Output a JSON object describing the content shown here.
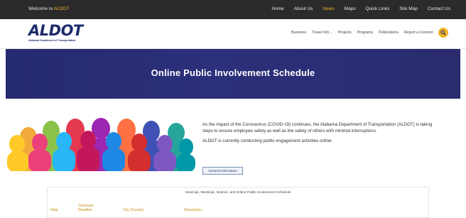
{
  "topbar": {
    "welcome_prefix": "Welcome to",
    "welcome_brand": "ALDOT",
    "links": [
      "Home",
      "About Us",
      "News",
      "Maps",
      "Quick Links",
      "Site Map",
      "Contact Us"
    ],
    "active_link": "News"
  },
  "header": {
    "logo_wordmark": "ALDOT",
    "logo_subtitle": "Alabama Department of Transportation",
    "nav": [
      "Business",
      "Travel Info",
      "Projects",
      "Programs",
      "Publications",
      "Report a Concern"
    ]
  },
  "hero": {
    "title": "Online Public Involvement Schedule"
  },
  "intro": {
    "paragraph_1": "As the impact of the Coronavirus (COVID-19) continues, the Alabama Department of Transportation (ALDOT) is taking steps to ensure employee safety as well as the safety of others with minimal interruptions.",
    "paragraph_2": "ALDOT is currently conducting public engagement activities online.",
    "button_label": "General Information"
  },
  "schedule_table": {
    "caption": "Hearings, Meetings, Notices, and Online Public Involvement Schedule",
    "columns": [
      "Date",
      "Comment Deadline",
      "City (County)",
      "Description"
    ]
  },
  "colors": {
    "topbar_bg": "#2b2b2b",
    "accent_gold": "#f0b429",
    "hero_blue": "#2a2d74",
    "brand_navy": "#1d2b6b"
  },
  "icons": {
    "search": "magnifier-icon",
    "nav_dropdown": "chevron-down-icon"
  }
}
